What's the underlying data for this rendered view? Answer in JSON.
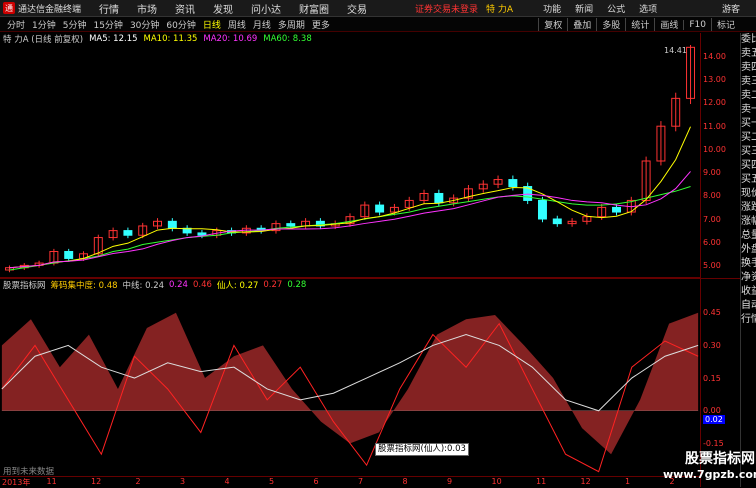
{
  "titlebar": {
    "app": "通达信金融终端",
    "menus": [
      "行情",
      "市场",
      "资讯",
      "发现",
      "问小达",
      "财富圈",
      "交易"
    ],
    "login": "证券交易未登录",
    "stock": "特 力A",
    "right_menus": [
      "功能",
      "新闻",
      "公式",
      "选项"
    ],
    "guest": "游客"
  },
  "periods": [
    "分时",
    "1分钟",
    "5分钟",
    "15分钟",
    "30分钟",
    "60分钟",
    "日线",
    "周线",
    "月线",
    "多周期",
    "更多"
  ],
  "active_period": "日线",
  "tools": [
    "复权",
    "叠加",
    "多股",
    "统计",
    "画线",
    "F10",
    "标记"
  ],
  "ma_line": {
    "name": "特 力A (日线 前复权)",
    "ma5": "MA5: 12.15",
    "ma10": "MA10: 11.35",
    "ma20": "MA20: 10.69",
    "ma60": "MA60: 8.38"
  },
  "ind_line": {
    "name": "股票指标网",
    "chip": "筹码集中度: 0.48",
    "mid": "中线: 0.24",
    "v1": "0.24",
    "v2": "0.46",
    "xianren": "仙人: 0.27",
    "v3": "0.27",
    "v4": "0.28"
  },
  "price_axis": [
    "14.00",
    "13.00",
    "12.00",
    "11.00",
    "10.00",
    "9.00",
    "8.00",
    "7.00",
    "6.00",
    "5.00"
  ],
  "ind_axis": [
    "0.45",
    "0.30",
    "0.15",
    "0.00",
    "-0.15"
  ],
  "zero_tag": "0.02",
  "peak_label": "14.41",
  "sidebar": [
    "委比",
    "卖五",
    "卖四",
    "卖三",
    "卖二",
    "卖一",
    "买一",
    "买二",
    "买三",
    "买四",
    "买五",
    "现价",
    "涨跌",
    "涨幅",
    "总量",
    "外盘",
    "换手",
    "净资",
    "收益",
    "自动",
    "行情"
  ],
  "time_axis": [
    "2013年",
    "11",
    "12",
    "2",
    "3",
    "4",
    "5",
    "6",
    "7",
    "8",
    "9",
    "10",
    "11",
    "12",
    "1",
    "2"
  ],
  "tooltip": "股票指标网(仙人):0.03",
  "no_data": "用到未来数据",
  "watermark": {
    "big": "股票指标网",
    "small": "www.7gpzb.com"
  },
  "colors": {
    "up": "#ff3333",
    "ma5": "#ffffff",
    "ma10": "#ffff00",
    "ma20": "#ff33ff",
    "ma60": "#33ff33"
  },
  "chart_data": {
    "type": "line",
    "title": "特 力A (日线 前复权)",
    "xlabel": "",
    "ylabel": "",
    "ylim": [
      4.5,
      14.5
    ],
    "close": [
      4.9,
      5.0,
      5.1,
      5.6,
      5.3,
      5.5,
      6.2,
      6.5,
      6.3,
      6.7,
      6.9,
      6.6,
      6.4,
      6.3,
      6.5,
      6.4,
      6.6,
      6.5,
      6.8,
      6.7,
      6.9,
      6.7,
      6.8,
      7.1,
      7.6,
      7.3,
      7.5,
      7.8,
      8.1,
      7.7,
      7.9,
      8.3,
      8.5,
      8.7,
      8.4,
      7.8,
      7.0,
      6.8,
      6.9,
      7.1,
      7.5,
      7.3,
      7.8,
      9.5,
      11.0,
      12.2,
      14.4
    ],
    "ma60": [
      4.8,
      4.9,
      5.0,
      5.1,
      5.2,
      5.3,
      5.4,
      5.6,
      5.7,
      5.9,
      6.0,
      6.1,
      6.2,
      6.25,
      6.3,
      6.4,
      6.45,
      6.5,
      6.6,
      6.65,
      6.7,
      6.75,
      6.8,
      6.9,
      7.0,
      7.1,
      7.2,
      7.3,
      7.45,
      7.55,
      7.65,
      7.75,
      7.85,
      7.95,
      8.0,
      7.95,
      7.85,
      7.75,
      7.65,
      7.6,
      7.6,
      7.65,
      7.75,
      7.9,
      8.05,
      8.2,
      8.4
    ]
  }
}
